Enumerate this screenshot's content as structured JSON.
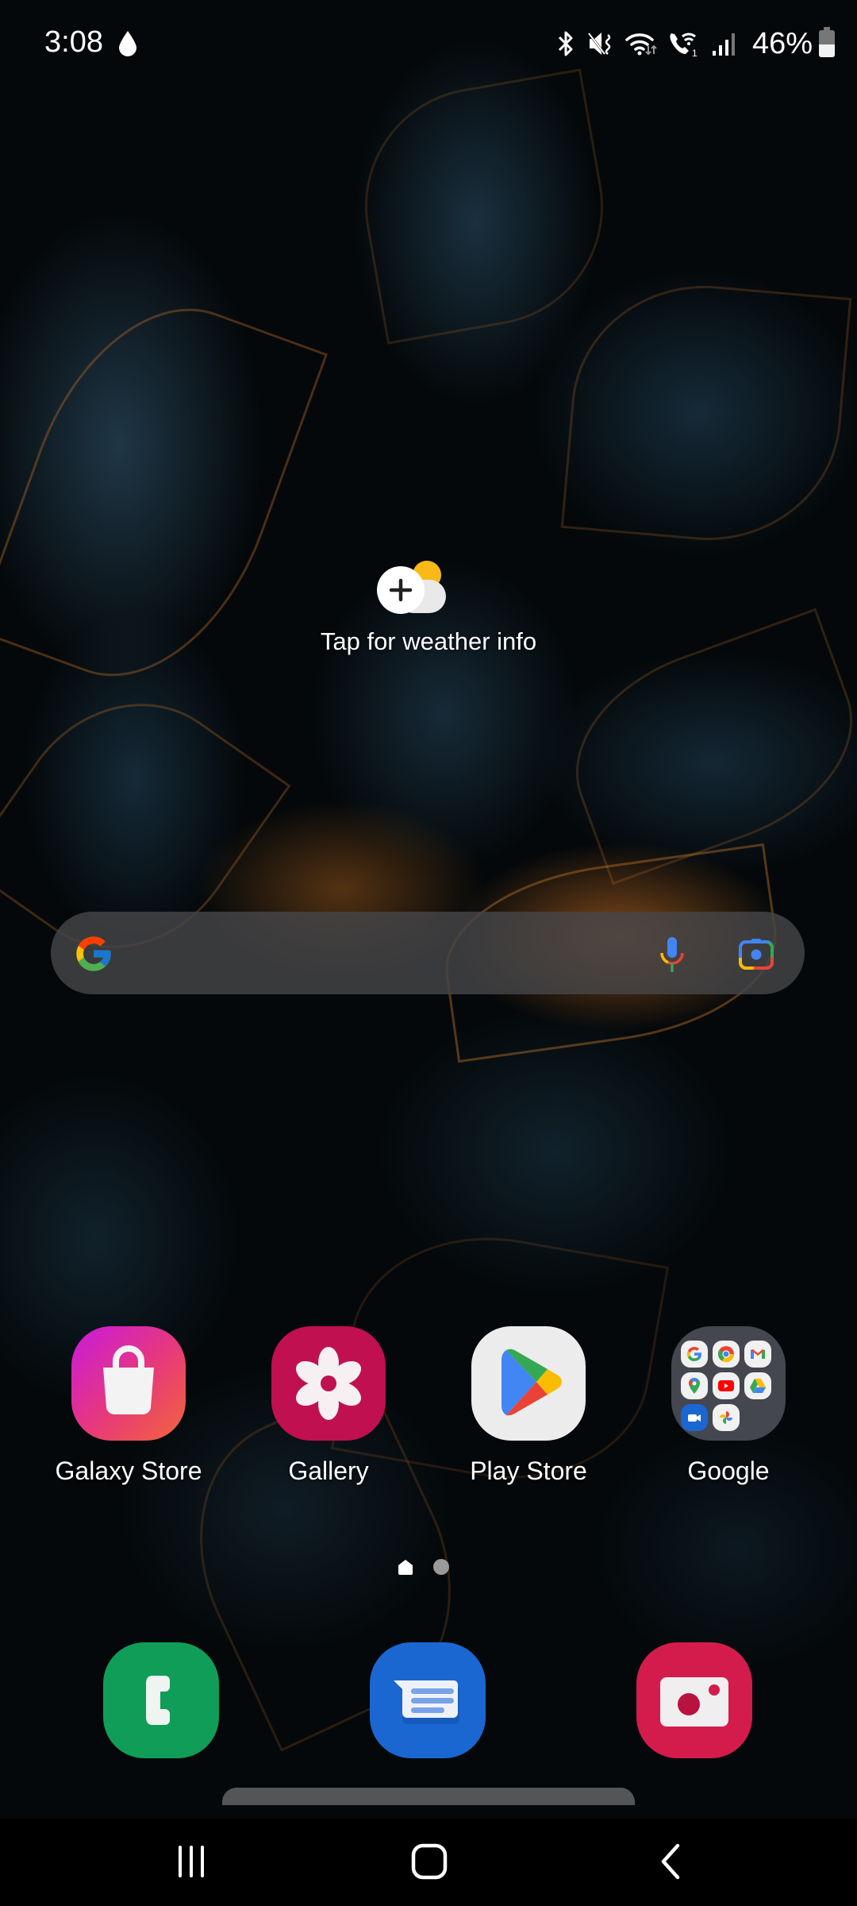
{
  "status_bar": {
    "time": "3:08",
    "notification_icons": [
      "water-drop-icon"
    ],
    "system_icons": [
      "bluetooth-icon",
      "mute-icon",
      "wifi-icon",
      "wifi-calling-icon",
      "signal-icon"
    ],
    "battery_percent_label": "46%",
    "battery_level": 0.46
  },
  "weather_widget": {
    "label": "Tap for weather info",
    "icon": "weather-add-icon"
  },
  "search_bar": {
    "logo": "google-g-icon",
    "mic_icon": "mic-icon",
    "lens_icon": "google-lens-icon"
  },
  "apps": [
    {
      "label": "Galaxy Store",
      "icon": "shopping-bag-icon"
    },
    {
      "label": "Gallery",
      "icon": "flower-icon"
    },
    {
      "label": "Play Store",
      "icon": "play-store-icon"
    },
    {
      "label": "Google",
      "icon": "folder-icon",
      "folder_items": [
        "Google",
        "Chrome",
        "Gmail",
        "Maps",
        "YouTube",
        "Drive",
        "Meet",
        "Photos"
      ]
    }
  ],
  "page_indicator": {
    "pages": 2,
    "current": 1
  },
  "dock": [
    {
      "name": "Phone",
      "icon": "phone-icon"
    },
    {
      "name": "Messages",
      "icon": "messages-icon"
    },
    {
      "name": "Camera",
      "icon": "camera-icon"
    }
  ],
  "nav_bar": {
    "recents": "recents-icon",
    "home": "home-icon",
    "back": "back-icon"
  },
  "colors": {
    "galaxy_store": "#d62a9c",
    "gallery": "#c0104f",
    "phone": "#109d58",
    "messages": "#1a67d2",
    "camera": "#d41c4c",
    "search_bar_bg": "#464648"
  }
}
